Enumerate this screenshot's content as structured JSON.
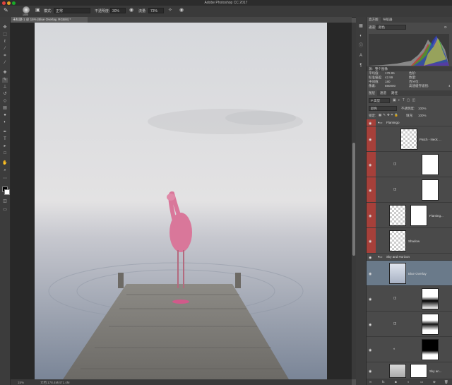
{
  "app": {
    "title": "Adobe Photoshop CC 2017"
  },
  "options_bar": {
    "size_value": "1000",
    "mode_label": "模式:",
    "mode_value": "正常",
    "opacity_label": "不透明度:",
    "opacity_value": "30%",
    "flow_label": "流量:",
    "flow_value": "73%"
  },
  "document": {
    "tab_label": "未标题-1 @ 15% (Blue Overlay, RGB/8) *",
    "zoom": "15%",
    "doc_size": "文档:178.4M/471.4M"
  },
  "histogram_panel": {
    "tabs": [
      "直方图",
      "导航器"
    ],
    "channel_label": "通道:",
    "channel_value": "颜色",
    "source_label": "源:",
    "source_value": "整个图像",
    "stats_left": [
      {
        "label": "平均值:",
        "value": "178.95"
      },
      {
        "label": "标准偏差:",
        "value": "42.99"
      },
      {
        "label": "中间值:",
        "value": "180"
      },
      {
        "label": "像素:",
        "value": "880000"
      }
    ],
    "stats_right": [
      {
        "label": "色阶:",
        "value": ""
      },
      {
        "label": "数量:",
        "value": ""
      },
      {
        "label": "百分位:",
        "value": ""
      },
      {
        "label": "高速缓存级别:",
        "value": "4"
      }
    ]
  },
  "layers_panel": {
    "tabs": [
      "图层",
      "通道",
      "路径"
    ],
    "kind_value": "P 类型",
    "blend_mode": "颜色",
    "opacity_label": "不透明度:",
    "opacity_value": "100%",
    "lock_label": "锁定:",
    "fill_label": "填充:",
    "fill_value": "100%",
    "layers": [
      {
        "name": "Flamingo",
        "type": "group",
        "highlight": "red"
      },
      {
        "name": "Patch - Neck ...",
        "type": "layer",
        "highlight": "red"
      },
      {
        "name": "",
        "type": "adjustment",
        "highlight": "red"
      },
      {
        "name": "",
        "type": "adjustment",
        "highlight": "red"
      },
      {
        "name": "Flaming...",
        "type": "layer",
        "highlight": "red"
      },
      {
        "name": "Shadow",
        "type": "layer",
        "highlight": "red"
      },
      {
        "name": "Sky and Horizon",
        "type": "group",
        "highlight": "none"
      },
      {
        "name": "Blue Overlay",
        "type": "layer",
        "highlight": "selected"
      },
      {
        "name": "",
        "type": "adjustment",
        "highlight": "none"
      },
      {
        "name": "",
        "type": "adjustment",
        "highlight": "none"
      },
      {
        "name": "",
        "type": "adjustment",
        "highlight": "none"
      },
      {
        "name": "Sky an...",
        "type": "layer",
        "highlight": "none"
      }
    ]
  },
  "colors": {
    "red_label": "#a6403a",
    "selected": "#6a7a8a",
    "panel": "#4a4a4a"
  },
  "tools": [
    "move-icon",
    "marquee-icon",
    "lasso-icon",
    "quick-select-icon",
    "crop-icon",
    "eyedropper-icon",
    "healing-icon",
    "brush-icon",
    "clone-stamp-icon",
    "history-brush-icon",
    "eraser-icon",
    "gradient-icon",
    "blur-icon",
    "dodge-icon",
    "pen-icon",
    "type-icon",
    "path-select-icon",
    "rectangle-icon",
    "hand-icon",
    "zoom-icon"
  ]
}
